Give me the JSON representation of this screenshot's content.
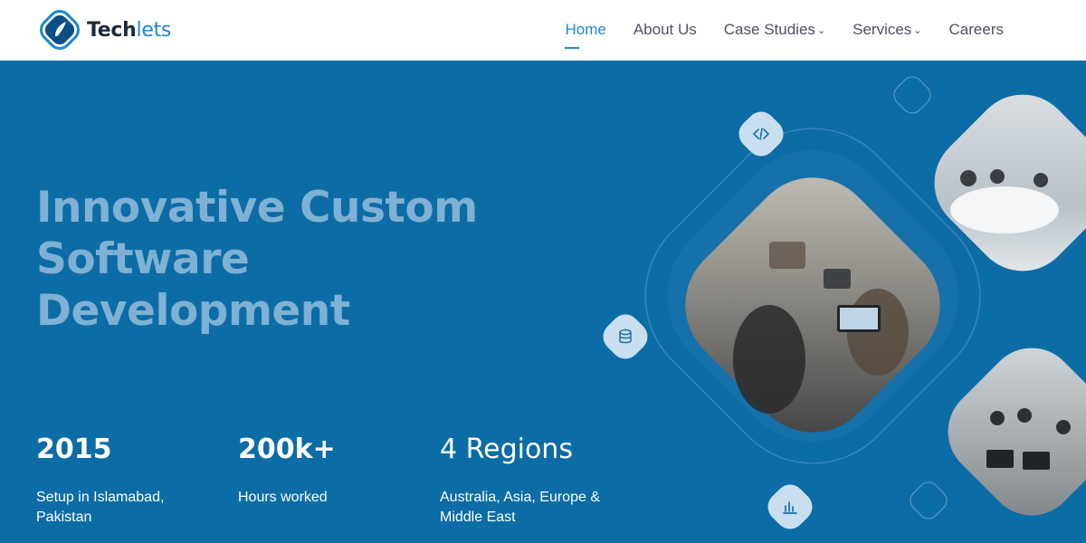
{
  "brand": {
    "name_bold": "Tech",
    "name_light": "lets"
  },
  "nav": {
    "items": [
      {
        "label": "Home",
        "active": true
      },
      {
        "label": "About Us"
      },
      {
        "label": "Case Studies",
        "dropdown": true
      },
      {
        "label": "Services",
        "dropdown": true
      },
      {
        "label": "Careers"
      }
    ]
  },
  "hero": {
    "headline_line1": "Innovative Custom",
    "headline_line2": "Software",
    "headline_line3": "Development"
  },
  "stats": [
    {
      "value": "2015",
      "label": "Setup in Islamabad, Pakistan"
    },
    {
      "value": "200k+",
      "label": "Hours worked"
    },
    {
      "value": "4 Regions",
      "label": "Australia, Asia, Europe & Middle East"
    }
  ],
  "icons": {
    "code": "code-icon",
    "database": "database-icon",
    "chart": "bar-chart-icon"
  },
  "colors": {
    "accent": "#1b88d6",
    "hero_bg": "#0c6ca6",
    "headline": "#7eb1d3",
    "tile": "#c9dff0"
  }
}
